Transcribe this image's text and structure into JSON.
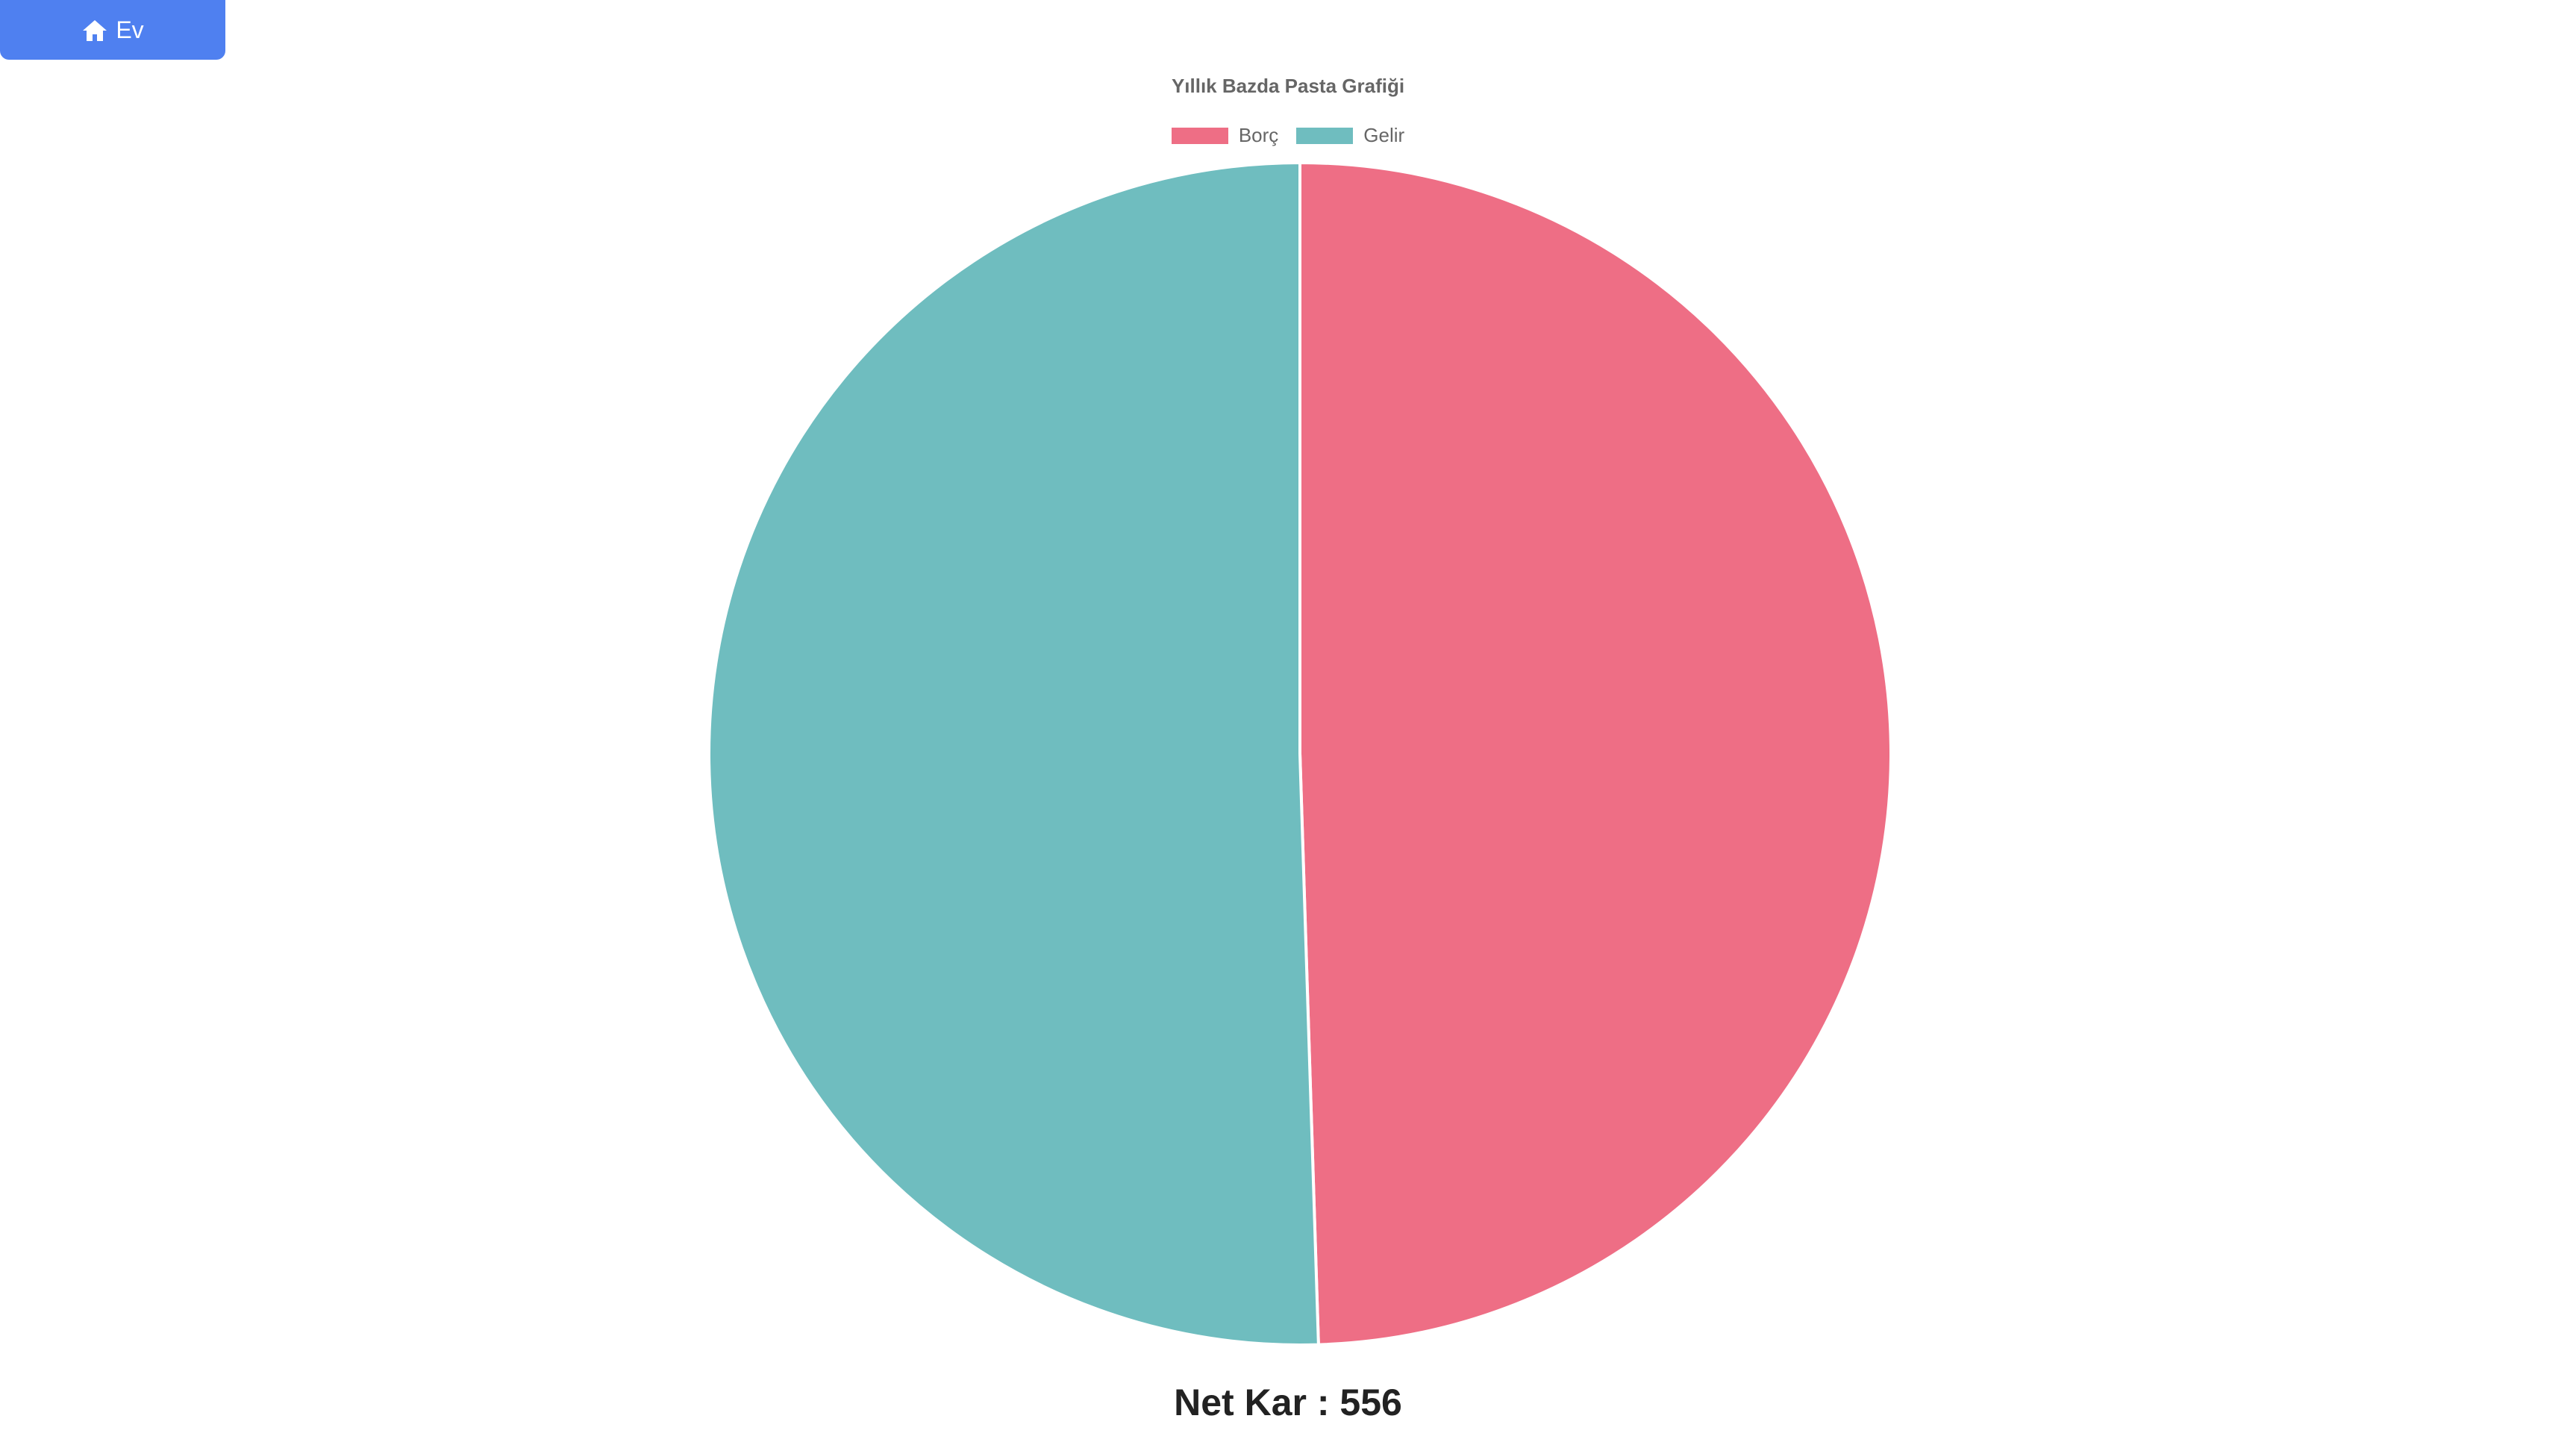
{
  "nav": {
    "home_label": "Ev"
  },
  "chart_data": {
    "type": "pie",
    "title": "Yıllık Bazda Pasta Grafiği",
    "legend_position": "top",
    "categories": [
      "Borç",
      "Gelir"
    ],
    "values": [
      49.5,
      50.5
    ],
    "colors": [
      "#ee6e85",
      "#6fbdbf"
    ]
  },
  "summary": {
    "net_profit_text": "Net Kar : 556"
  },
  "colors": {
    "home_button": "#4f80f0",
    "slice_border": "#ffffff"
  }
}
